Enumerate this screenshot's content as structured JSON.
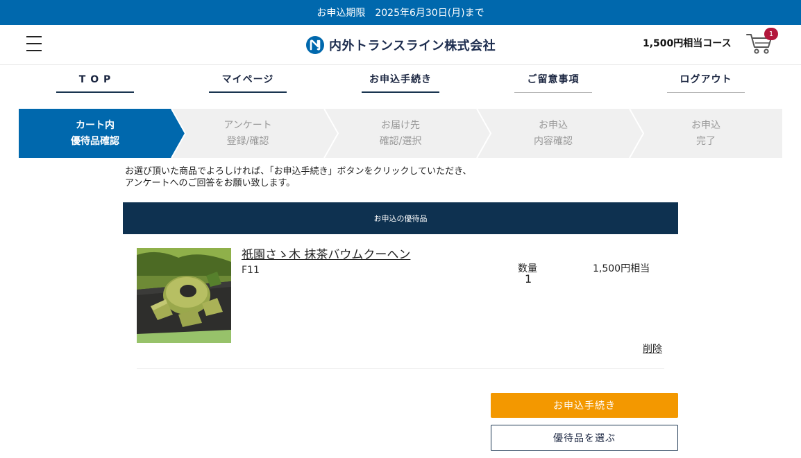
{
  "topbar": {
    "deadline_text": "お申込期限　2025年6月30日(月)まで"
  },
  "header": {
    "company_name": "内外トランスライン株式会社",
    "course_label": "1,500円相当コース",
    "cart_count": "1"
  },
  "nav": {
    "items": [
      {
        "label": "T O P"
      },
      {
        "label": "マイページ"
      },
      {
        "label": "お申込手続き"
      },
      {
        "label": "ご留意事項"
      },
      {
        "label": "ログアウト"
      }
    ]
  },
  "steps": [
    {
      "line1": "カート内",
      "line2": "優待品確認",
      "active": true
    },
    {
      "line1": "アンケート",
      "line2": "登録/確認",
      "active": false
    },
    {
      "line1": "お届け先",
      "line2": "確認/選択",
      "active": false
    },
    {
      "line1": "お申込",
      "line2": "内容確認",
      "active": false
    },
    {
      "line1": "お申込",
      "line2": "完了",
      "active": false
    }
  ],
  "intro": {
    "line1": "お選び頂いた商品でよろしければ、「お申込手続き」ボタンをクリックしていただき、",
    "line2": "アンケートへのご回答をお願い致します。"
  },
  "panel": {
    "title": "お申込の優待品"
  },
  "product": {
    "name": "祇園さゝ木 抹茶バウムクーヘン",
    "code": "F11",
    "qty_label": "数量",
    "qty_value": "1",
    "price": "1,500円相当",
    "delete_label": "削除"
  },
  "buttons": {
    "proceed": "お申込手続き",
    "choose": "優待品を選ぶ"
  },
  "colors": {
    "brand_blue": "#0068ad",
    "navy": "#0e3150",
    "orange": "#f39800",
    "badge_red": "#b3173c"
  },
  "icons": [
    "menu-icon",
    "logo-mark-icon",
    "cart-icon"
  ]
}
